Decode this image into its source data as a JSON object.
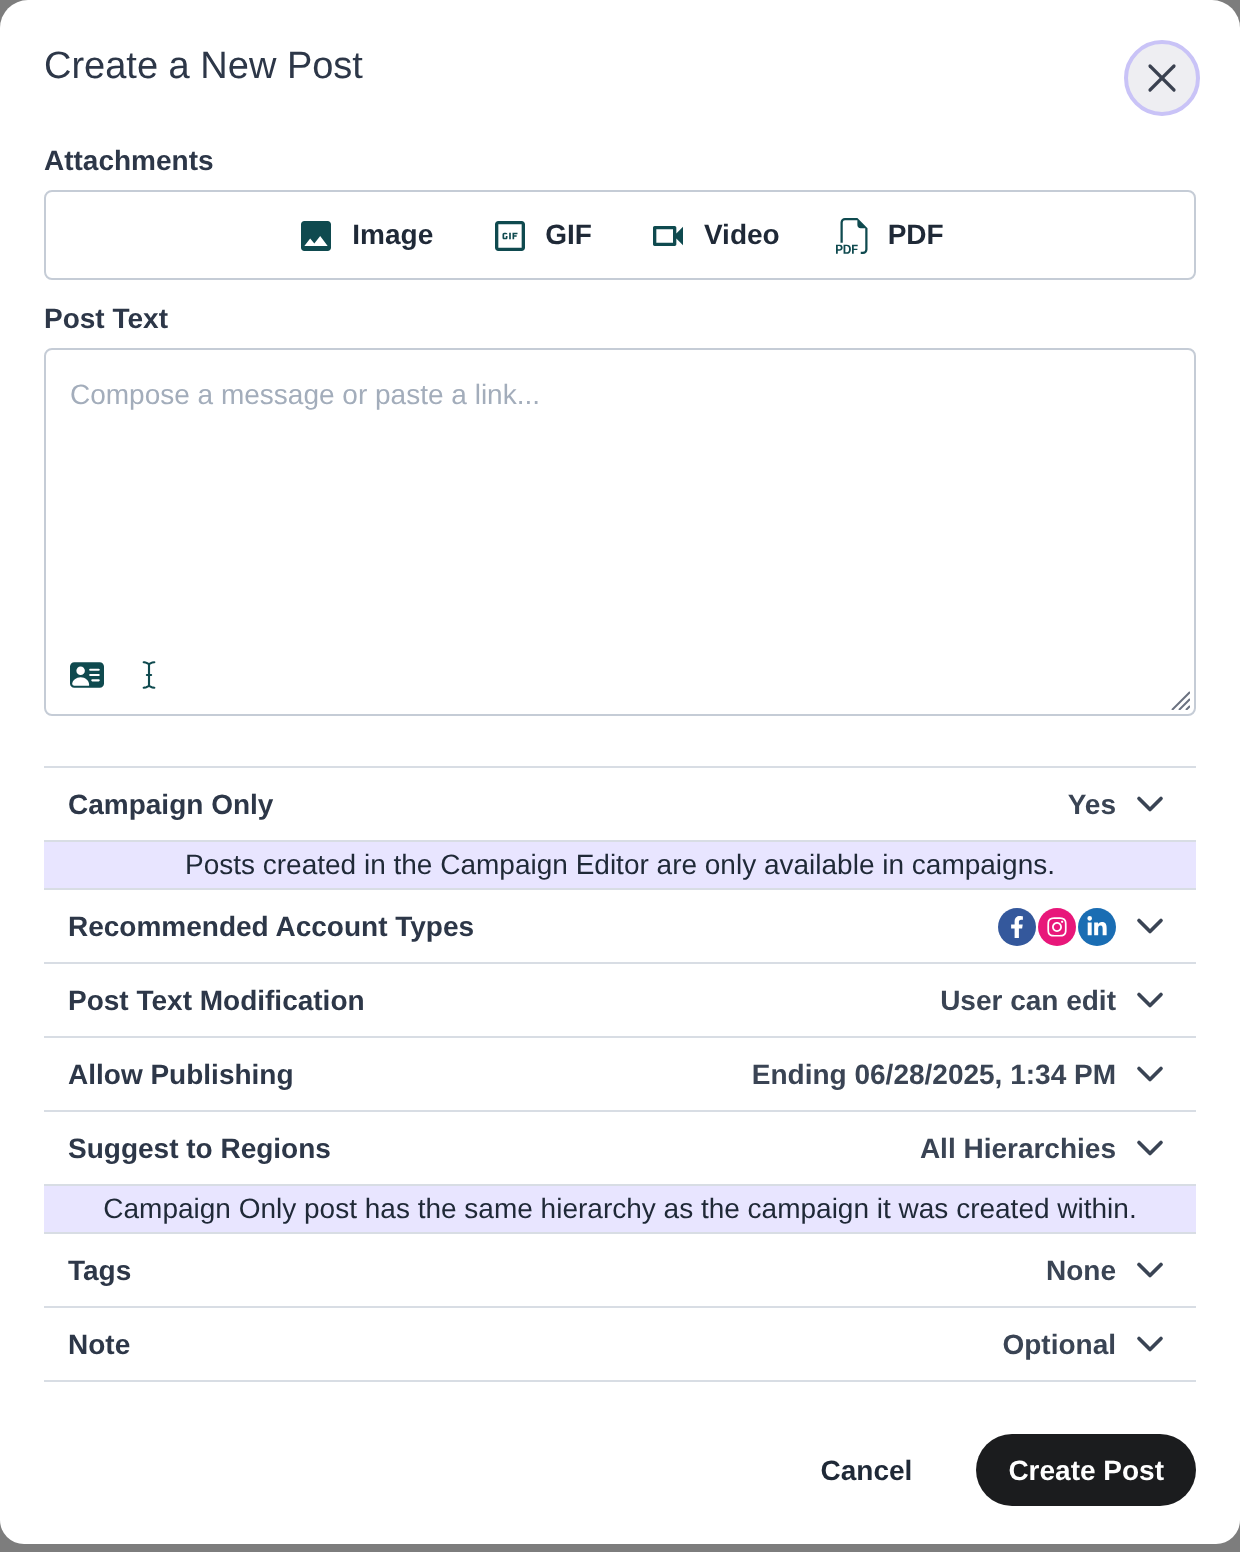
{
  "dialog": {
    "title": "Create a New Post"
  },
  "attachments": {
    "label": "Attachments",
    "options": [
      {
        "kind": "image",
        "label": "Image"
      },
      {
        "kind": "gif",
        "label": "GIF"
      },
      {
        "kind": "video",
        "label": "Video"
      },
      {
        "kind": "pdf",
        "label": "PDF"
      }
    ]
  },
  "post_text": {
    "label": "Post Text",
    "placeholder": "Compose a message or paste a link..."
  },
  "settings": [
    {
      "kind": "text",
      "label": "Campaign Only",
      "value": "Yes",
      "note": "Posts created in the Campaign Editor are only available in campaigns."
    },
    {
      "kind": "accounts",
      "label": "Recommended Account Types",
      "accounts": [
        {
          "kind": "facebook",
          "color": "#34589c"
        },
        {
          "kind": "instagram",
          "color": "#e8177a"
        },
        {
          "kind": "linkedin",
          "color": "#1a6db3"
        }
      ]
    },
    {
      "kind": "text",
      "label": "Post Text Modification",
      "value": "User can edit"
    },
    {
      "kind": "text",
      "label": "Allow Publishing",
      "value": "Ending 06/28/2025, 1:34 PM"
    },
    {
      "kind": "text",
      "label": "Suggest to Regions",
      "value": "All Hierarchies",
      "note": "Campaign Only post has the same hierarchy as the campaign it was created within."
    },
    {
      "kind": "text",
      "label": "Tags",
      "value": "None"
    },
    {
      "kind": "text",
      "label": "Note",
      "value": "Optional"
    }
  ],
  "buttons": [
    {
      "kind": "secondary",
      "label": "Cancel"
    },
    {
      "kind": "primary",
      "label": "Create Post"
    }
  ]
}
